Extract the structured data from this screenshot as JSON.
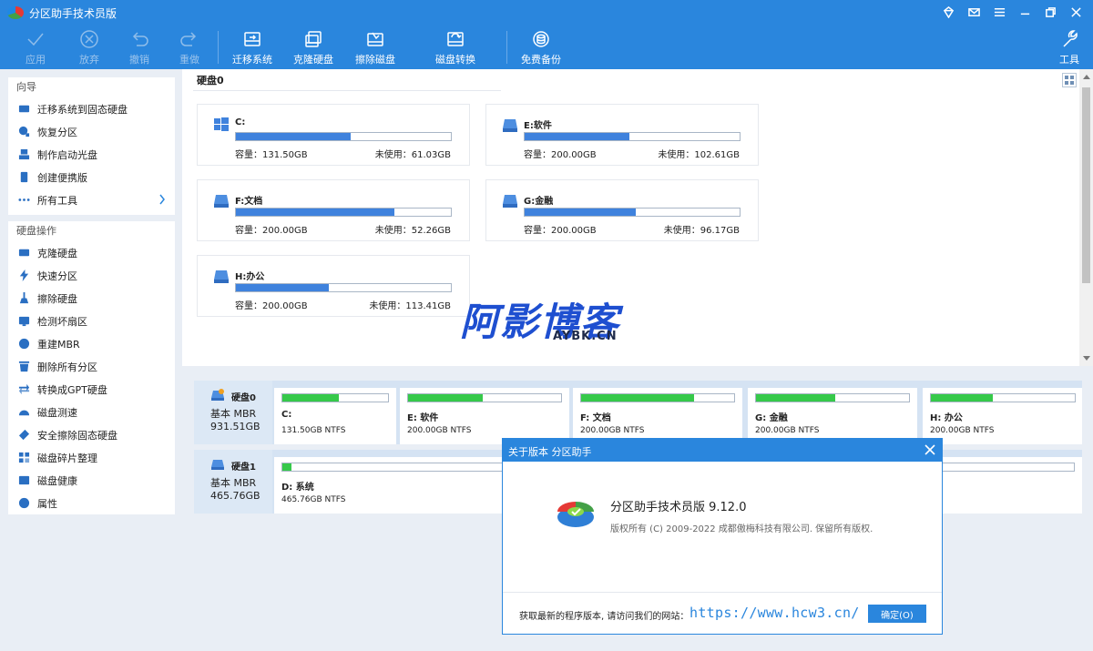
{
  "app": {
    "title": "分区助手技术员版",
    "accent": "#2a86dd"
  },
  "toolbar": {
    "apply": "应用",
    "discard": "放弃",
    "undo": "撤销",
    "redo": "重做",
    "migrate": "迁移系统",
    "clone": "克隆硬盘",
    "wipe": "擦除磁盘",
    "convert": "磁盘转换",
    "backup": "免费备份",
    "tools": "工具"
  },
  "sidebar": {
    "wizard_title": "向导",
    "wizard_items": [
      "迁移系统到固态硬盘",
      "恢复分区",
      "制作启动光盘",
      "创建便携版",
      "所有工具"
    ],
    "ops_title": "硬盘操作",
    "ops_items": [
      "克隆硬盘",
      "快速分区",
      "擦除硬盘",
      "检测坏扇区",
      "重建MBR",
      "删除所有分区",
      "转换成GPT硬盘",
      "磁盘测速",
      "安全擦除固态硬盘",
      "磁盘碎片整理",
      "磁盘健康",
      "属性"
    ]
  },
  "upper": {
    "disk_label": "硬盘0",
    "cards": [
      {
        "name": "C:",
        "used_fraction": 0.536,
        "capacity": "容量：131.50GB",
        "free": "未使用：61.03GB"
      },
      {
        "name": "E:软件",
        "used_fraction": 0.487,
        "capacity": "容量：200.00GB",
        "free": "未使用：102.61GB"
      },
      {
        "name": "F:文档",
        "used_fraction": 0.739,
        "capacity": "容量：200.00GB",
        "free": "未使用：52.26GB"
      },
      {
        "name": "G:金融",
        "used_fraction": 0.519,
        "capacity": "容量：200.00GB",
        "free": "未使用：96.17GB"
      },
      {
        "name": "H:办公",
        "used_fraction": 0.433,
        "capacity": "容量：200.00GB",
        "free": "未使用：113.41GB"
      }
    ]
  },
  "lower": {
    "disks": [
      {
        "name": "硬盘0",
        "type": "基本 MBR",
        "size": "931.51GB",
        "parts": [
          {
            "name": "C:",
            "info": "131.50GB NTFS",
            "used_fraction": 0.536
          },
          {
            "name": "E: 软件",
            "info": "200.00GB NTFS",
            "used_fraction": 0.487
          },
          {
            "name": "F: 文档",
            "info": "200.00GB NTFS",
            "used_fraction": 0.739
          },
          {
            "name": "G: 金融",
            "info": "200.00GB NTFS",
            "used_fraction": 0.519
          },
          {
            "name": "H: 办公",
            "info": "200.00GB NTFS",
            "used_fraction": 0.433
          }
        ]
      },
      {
        "name": "硬盘1",
        "type": "基本 MBR",
        "size": "465.76GB",
        "parts": [
          {
            "name": "D: 系统",
            "info": "465.76GB NTFS",
            "used_fraction": 0.012
          }
        ]
      }
    ]
  },
  "watermark": {
    "big": "阿影博客",
    "small": "AYBK.CN"
  },
  "dialog": {
    "title": "关于版本 分区助手",
    "product": "分区助手技术员版 9.12.0",
    "copyright": "版权所有 (C) 2009-2022 成都傲梅科技有限公司. 保留所有版权.",
    "foot_text": "获取最新的程序版本, 请访问我们的网站：",
    "url": "https://www.hcw3.cn/",
    "ok_label": "确定(O)"
  }
}
